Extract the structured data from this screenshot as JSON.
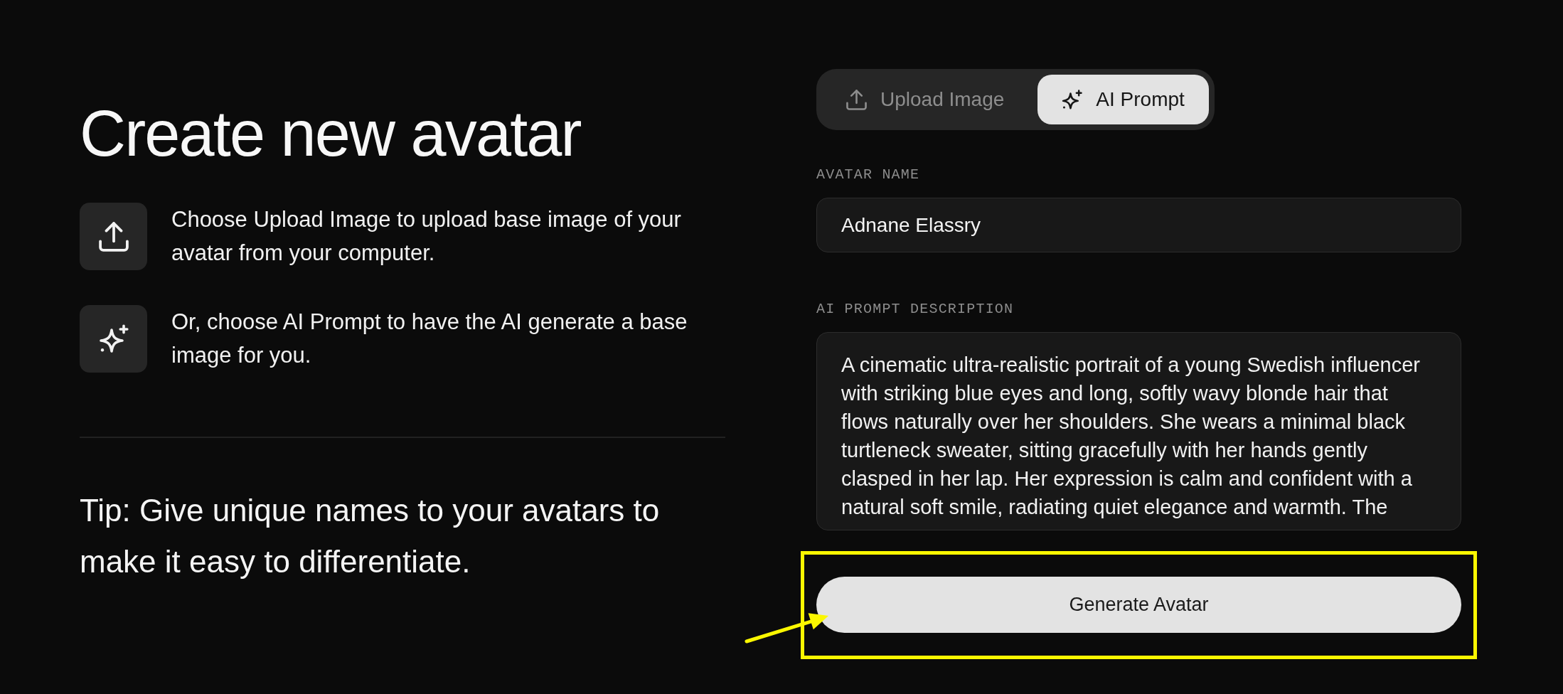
{
  "intro": {
    "title": "Create new avatar",
    "steps": [
      {
        "kind": "upload",
        "text": "Choose Upload Image to upload base image of your avatar from your computer."
      },
      {
        "kind": "prompt",
        "text": "Or, choose AI Prompt to have the AI generate a base image for you."
      }
    ],
    "tip": "Tip: Give unique names to your avatars to make it easy to differentiate."
  },
  "tabs": [
    {
      "kind": "upload",
      "label": "Upload Image",
      "selected": false
    },
    {
      "kind": "prompt",
      "label": "AI Prompt",
      "selected": true
    }
  ],
  "form": {
    "fields": [
      {
        "kind": "input",
        "label": "AVATAR NAME",
        "value": "Adnane Elassry"
      },
      {
        "kind": "textarea",
        "label": "AI PROMPT DESCRIPTION",
        "value": "A cinematic ultra-realistic portrait of a young Swedish influencer with striking blue eyes and long, softly wavy blonde hair that flows naturally over her shoulders. She wears a minimal black turtleneck sweater, sitting gracefully with her hands gently clasped in her lap. Her expression is calm and confident with a natural soft smile, radiating quiet elegance and warmth. The"
      }
    ],
    "submit": "Generate Avatar"
  }
}
